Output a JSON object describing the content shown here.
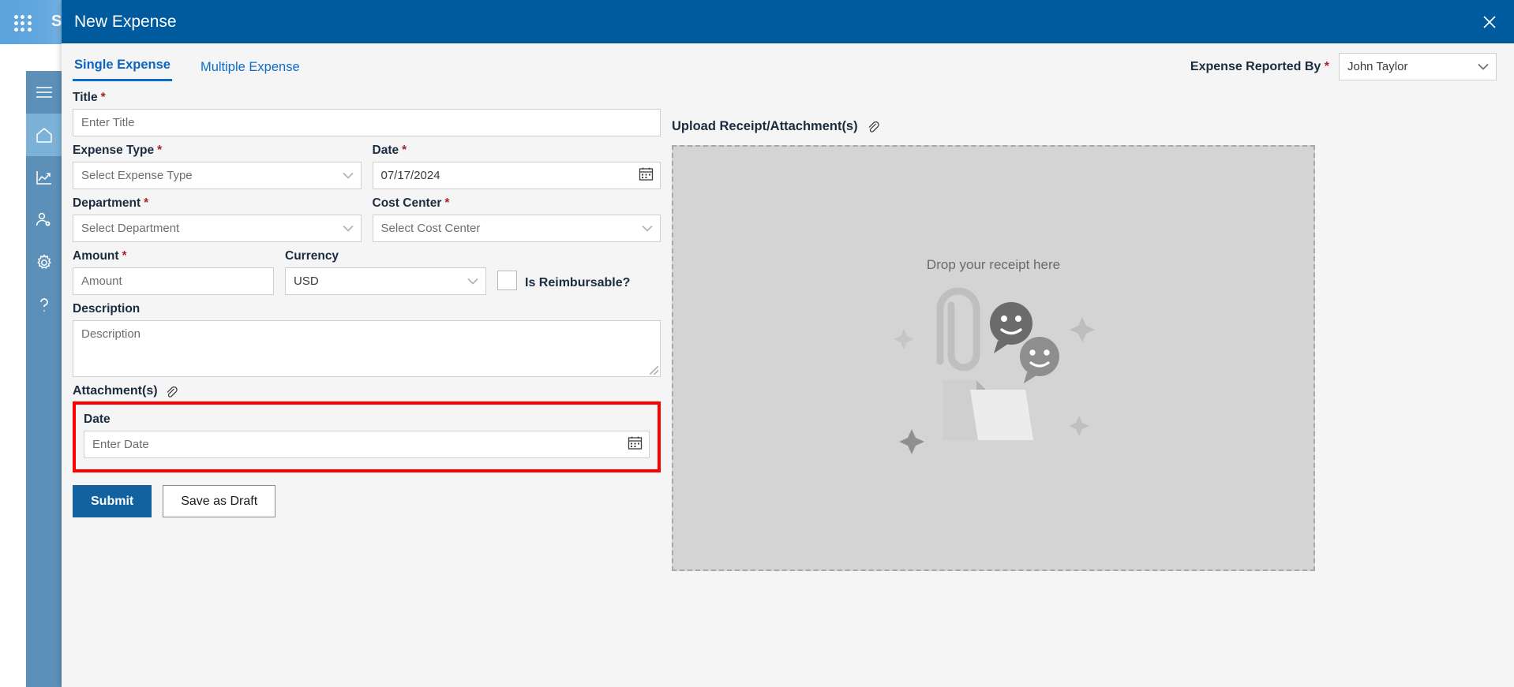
{
  "app": {
    "brand": "S",
    "waffle_icon": "grid-apps-icon"
  },
  "sidebar": {
    "items": [
      {
        "name": "menu",
        "icon": "hamburger-menu-icon",
        "active": false
      },
      {
        "name": "home",
        "icon": "home-icon",
        "active": true
      },
      {
        "name": "analytics",
        "icon": "chart-trend-icon",
        "active": false
      },
      {
        "name": "user-management",
        "icon": "user-settings-icon",
        "active": false
      },
      {
        "name": "settings",
        "icon": "gear-icon",
        "active": false
      },
      {
        "name": "help",
        "icon": "question-mark-icon",
        "active": false
      }
    ]
  },
  "modal": {
    "title": "New Expense",
    "close_icon": "close-icon"
  },
  "tabs": [
    {
      "label": "Single Expense",
      "active": true
    },
    {
      "label": "Multiple Expense",
      "active": false
    }
  ],
  "reported_by": {
    "label": "Expense Reported By",
    "required_mark": "*",
    "value": "John Taylor",
    "chevron_icon": "chevron-down-icon"
  },
  "form": {
    "title": {
      "label": "Title",
      "required_mark": "*",
      "placeholder": "Enter Title",
      "value": ""
    },
    "expense_type": {
      "label": "Expense Type",
      "required_mark": "*",
      "placeholder": "Select Expense Type",
      "value": ""
    },
    "date": {
      "label": "Date",
      "required_mark": "*",
      "value": "07/17/2024",
      "calendar_icon": "calendar-icon"
    },
    "department": {
      "label": "Department",
      "required_mark": "*",
      "placeholder": "Select Department",
      "value": ""
    },
    "cost_center": {
      "label": "Cost Center",
      "required_mark": "*",
      "placeholder": "Select Cost Center",
      "value": ""
    },
    "amount": {
      "label": "Amount",
      "required_mark": "*",
      "placeholder": "Amount",
      "value": ""
    },
    "currency": {
      "label": "Currency",
      "value": "USD"
    },
    "reimbursable": {
      "label": "Is Reimbursable?",
      "checked": false
    },
    "description": {
      "label": "Description",
      "placeholder": "Description",
      "value": ""
    },
    "attachments": {
      "label": "Attachment(s)",
      "clip_icon": "paperclip-icon"
    },
    "attachment_date": {
      "label": "Date",
      "placeholder": "Enter Date",
      "value": "",
      "calendar_icon": "calendar-icon"
    }
  },
  "buttons": {
    "submit": "Submit",
    "save_draft": "Save as Draft"
  },
  "upload": {
    "title": "Upload Receipt/Attachment(s)",
    "clip_icon": "paperclip-icon",
    "drop_text": "Drop your receipt here"
  },
  "colors": {
    "header_blue": "#005a9e",
    "primary_blue": "#11629f",
    "tab_blue": "#0c6dc7",
    "rail_blue": "#5d90b8",
    "rail_active": "#7cb2d8",
    "required_red": "#a4262c",
    "highlight_red": "#ff0000",
    "dropzone_bg": "#d4d4d4"
  }
}
